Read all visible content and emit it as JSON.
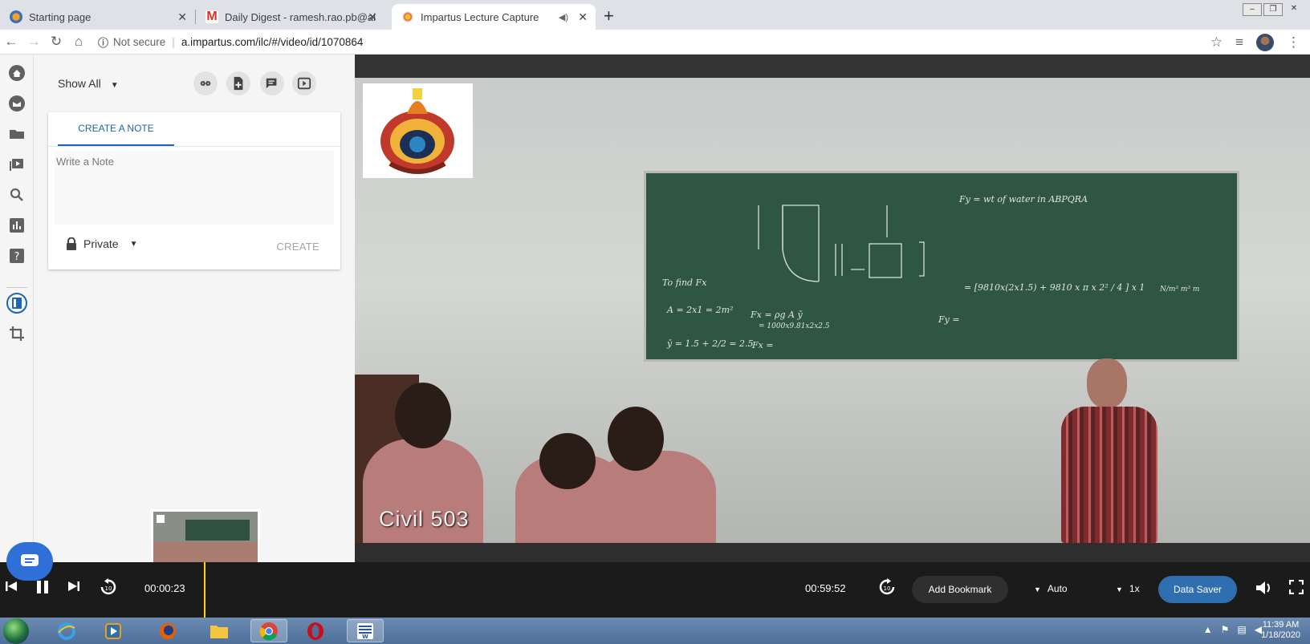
{
  "browser": {
    "tabs": [
      {
        "title": "Starting page",
        "close": "✕",
        "active": false
      },
      {
        "title": "Daily Digest - ramesh.rao.pb@ai",
        "close": "✕",
        "active": false
      },
      {
        "title": "Impartus Lecture Capture",
        "close": "✕",
        "active": true
      }
    ],
    "new_tab": "+",
    "security": "Not secure",
    "url": "a.impartus.com/ilc/#/video/id/1070864"
  },
  "notes_panel": {
    "filter_label": "Show All",
    "create_tab_label": "CREATE A NOTE",
    "note_placeholder": "Write a Note",
    "privacy_label": "Private",
    "create_button": "CREATE"
  },
  "video": {
    "caption": "Civil 503",
    "board_text": {
      "fy_line1": "Fy = wt of water in ABPQRA",
      "to_find": "To find Fx",
      "a_eq": "A = 2x1 = 2m²",
      "fx_eq": "Fx = ρg A ȳ",
      "fx_val": "= 1000x9.81x2x2.5",
      "ybar": "ȳ = 1.5 + 2/2 = 2.5",
      "fx_end": "Fx =",
      "fy_mid": "= [9810x(2x1.5) + 9810 x π x 2² / 4 ] x 1",
      "fy_end": "Fy =",
      "units": "N/m³ m³ m"
    }
  },
  "player": {
    "current_time": "00:00:23",
    "total_time": "00:59:52",
    "bookmark_button": "Add Bookmark",
    "quality": "Auto",
    "speed": "1x",
    "data_saver": "Data Saver",
    "progress": 0.0064
  },
  "taskbar": {
    "time": "11:39 AM",
    "date": "1/18/2020"
  },
  "colors": {
    "accent": "#1e66b0",
    "data_saver_bg": "#2f6fb0",
    "scrubber": "#ffd400",
    "chat_bubble": "#2f6fd8"
  }
}
